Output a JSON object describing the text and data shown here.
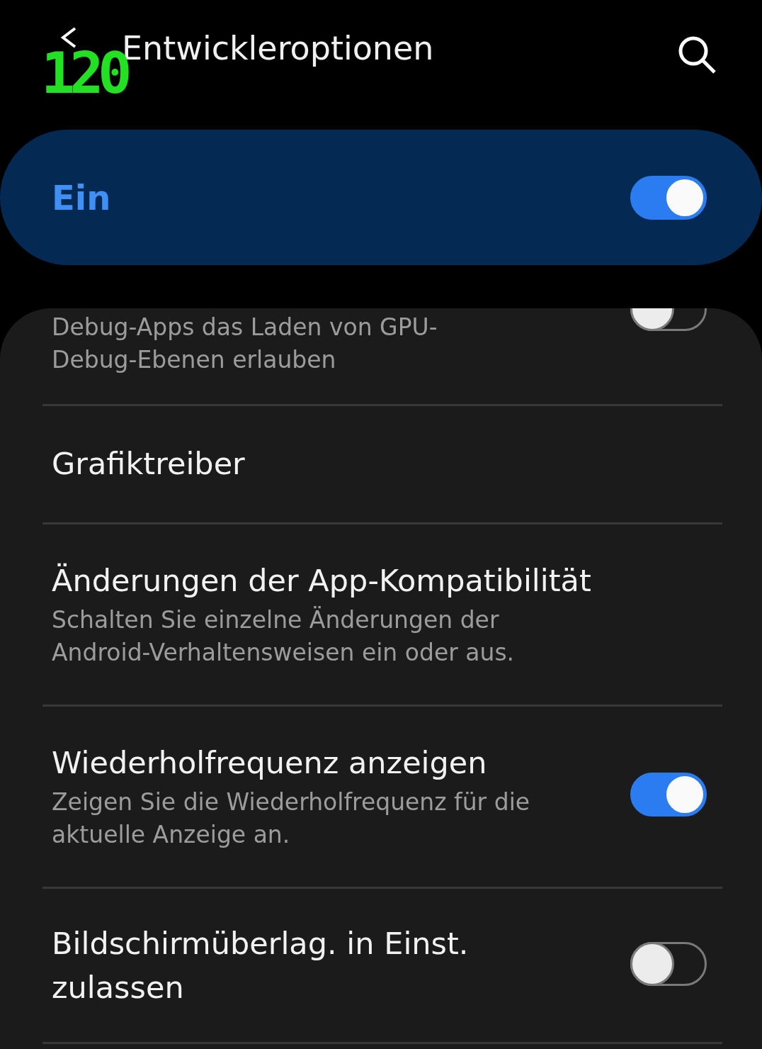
{
  "header": {
    "overlay": "120",
    "title": "Entwickleroptionen"
  },
  "master": {
    "label": "Ein",
    "on": true
  },
  "items": [
    {
      "kind": "partial",
      "subtitle": "Debug-Apps das Laden von GPU-Debug-Ebenen erlauben",
      "on": false
    },
    {
      "kind": "plain",
      "title": "Grafiktreiber"
    },
    {
      "kind": "plain",
      "title": "Änderungen der App-Kompatibilität",
      "subtitle": "Schalten Sie einzelne Änderungen der Android-Verhaltensweisen ein oder aus."
    },
    {
      "kind": "switch",
      "title": "Wiederholfrequenz anzeigen",
      "subtitle": "Zeigen Sie die Wiederholfrequenz für die aktuelle Anzeige an.",
      "on": true
    },
    {
      "kind": "switch",
      "title": "Bildschirmüberlag. in Einst. zulassen",
      "on": false
    }
  ]
}
